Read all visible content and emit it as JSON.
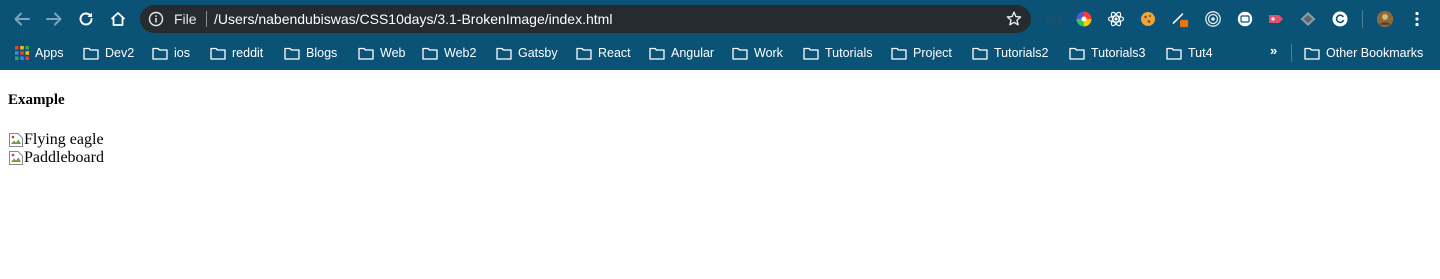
{
  "toolbar": {
    "url_scheme": "File",
    "url": "/Users/nabendubiswas/CSS10days/3.1-BrokenImage/index.html"
  },
  "bookmarks": {
    "apps_label": "Apps",
    "items": [
      "Dev2",
      "ios",
      "reddit",
      "Blogs",
      "Web",
      "Web2",
      "Gatsby",
      "React",
      "Angular",
      "Work",
      "Tutorials",
      "Project",
      "Tutorials2",
      "Tutorials3",
      "Tut4"
    ],
    "overflow_label": "»",
    "other_label": "Other Bookmarks"
  },
  "page": {
    "heading": "Example",
    "images": [
      {
        "alt": "Flying eagle"
      },
      {
        "alt": "Paddleboard"
      }
    ]
  },
  "colors": {
    "chrome_bg": "#0a5377",
    "omnibox_bg": "#262b30",
    "page_bg": "#ffffff"
  }
}
